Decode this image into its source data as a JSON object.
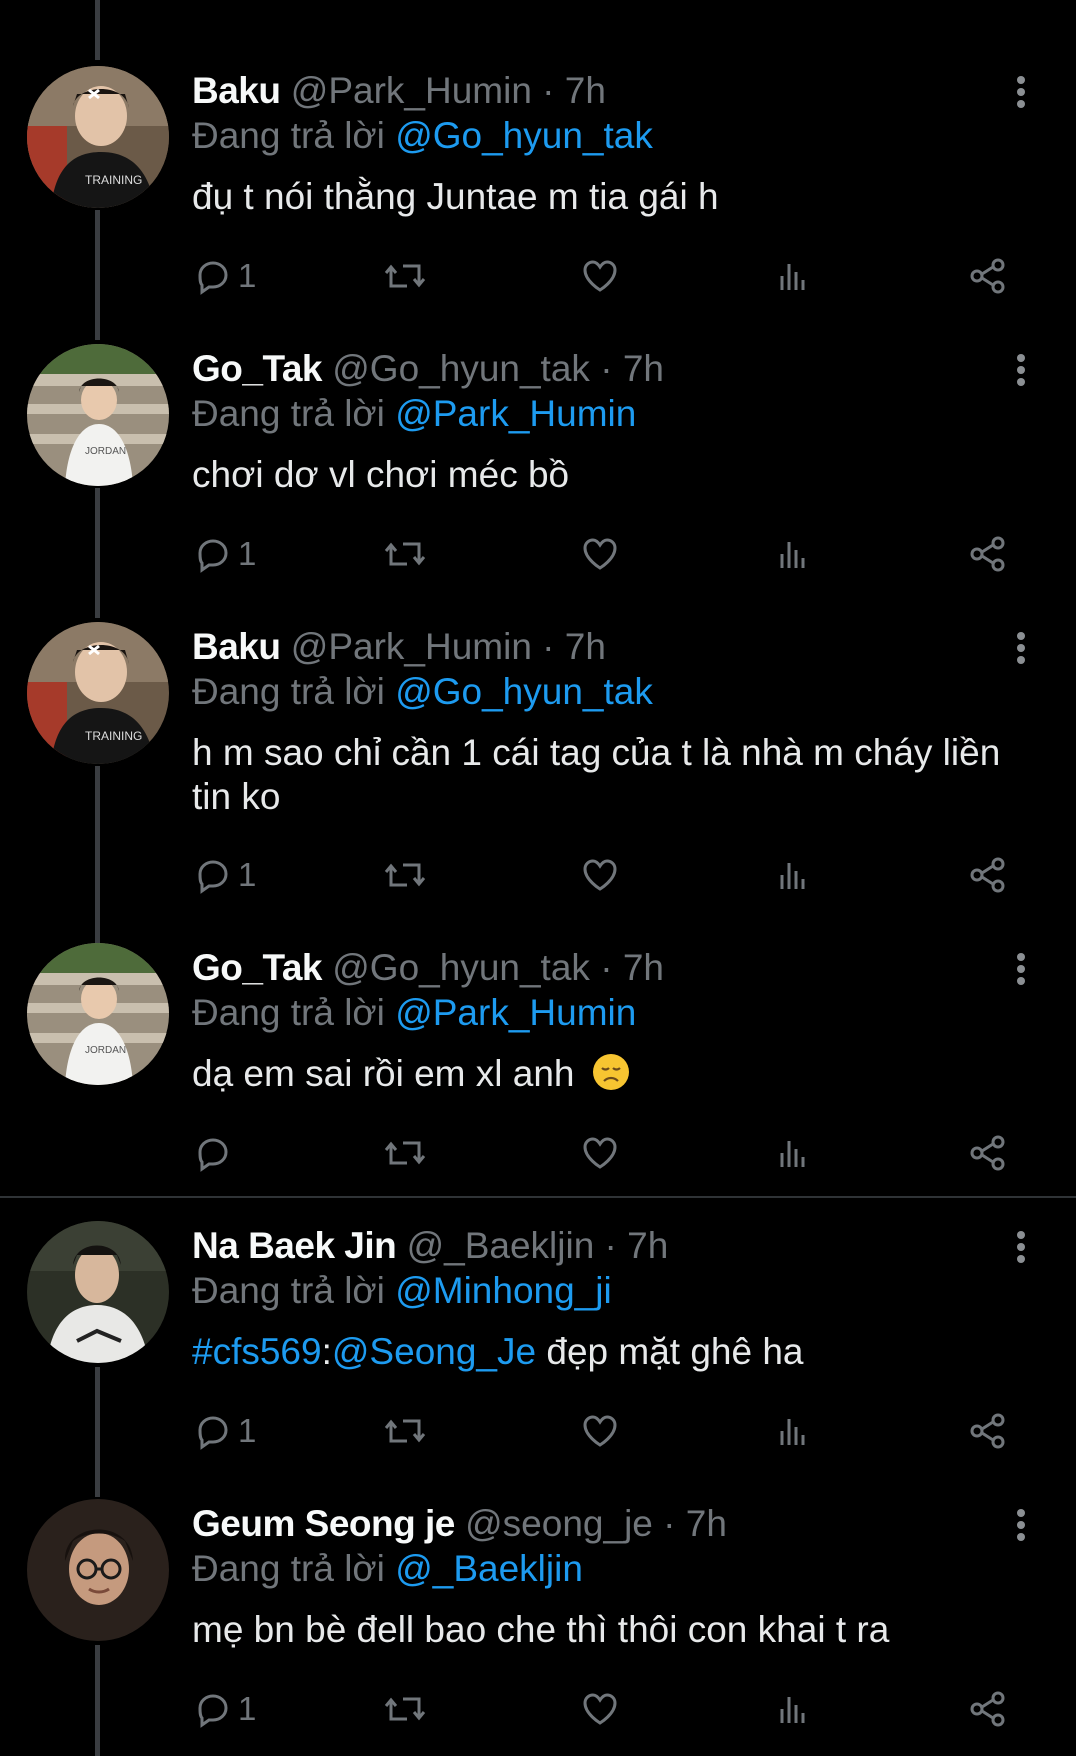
{
  "tweets": [
    {
      "name": "Baku",
      "handle": "@Park_Humin",
      "dot": " · ",
      "time": "7h",
      "reply_prefix": "Đang trả lời ",
      "reply_to": "@Go_hyun_tak",
      "text_line1": "đụ t nói thằng Juntae m tia gái h",
      "reply_count": "1",
      "avatar_icon": "avatar-baku"
    },
    {
      "name": "Go_Tak",
      "handle": "@Go_hyun_tak",
      "dot": " · ",
      "time": "7h",
      "reply_prefix": "Đang trả lời ",
      "reply_to": "@Park_Humin",
      "text_line1": "chơi dơ vl chơi méc bồ",
      "reply_count": "1",
      "avatar_icon": "avatar-gotak"
    },
    {
      "name": "Baku",
      "handle": "@Park_Humin",
      "dot": " · ",
      "time": "7h",
      "reply_prefix": "Đang trả lời ",
      "reply_to": "@Go_hyun_tak",
      "text_line1": "h m sao chỉ cần 1 cái tag của t là nhà m cháy liền",
      "text_line2": "tin ko",
      "reply_count": "1",
      "avatar_icon": "avatar-baku"
    },
    {
      "name": "Go_Tak",
      "handle": "@Go_hyun_tak",
      "dot": " · ",
      "time": "7h",
      "reply_prefix": "Đang trả lời ",
      "reply_to": "@Park_Humin",
      "text_line1": "dạ em sai rồi em xl anh",
      "emoji": "disappointed-face",
      "reply_count": "",
      "avatar_icon": "avatar-gotak"
    },
    {
      "name": "Na Baek Jin",
      "handle": "@_Baekljin",
      "dot": " · ",
      "time": "7h",
      "reply_prefix": "Đang trả lời ",
      "reply_to": "@Minhong_ji",
      "hashtag": "#cfs569",
      "colon": ":",
      "mention": "@Seong_Je",
      "text_rest": " đẹp mặt ghê ha",
      "reply_count": "1",
      "avatar_icon": "avatar-baekjin"
    },
    {
      "name": "Geum Seong je",
      "handle": "@seong_je",
      "dot": " · ",
      "time": "7h",
      "reply_prefix": "Đang trả lời ",
      "reply_to": "@_Baekljin",
      "text_line1": "mẹ bn bè đell bao che thì thôi con khai t ra",
      "reply_count": "1",
      "avatar_icon": "avatar-seongje"
    }
  ],
  "icons": {
    "reply": "reply-icon",
    "retweet": "retweet-icon",
    "like": "like-icon",
    "views": "views-icon",
    "share": "share-icon",
    "more": "more-icon"
  },
  "colors": {
    "background": "#000000",
    "link": "#1d9bf0",
    "muted": "#71767b",
    "text": "#e7e9ea"
  }
}
